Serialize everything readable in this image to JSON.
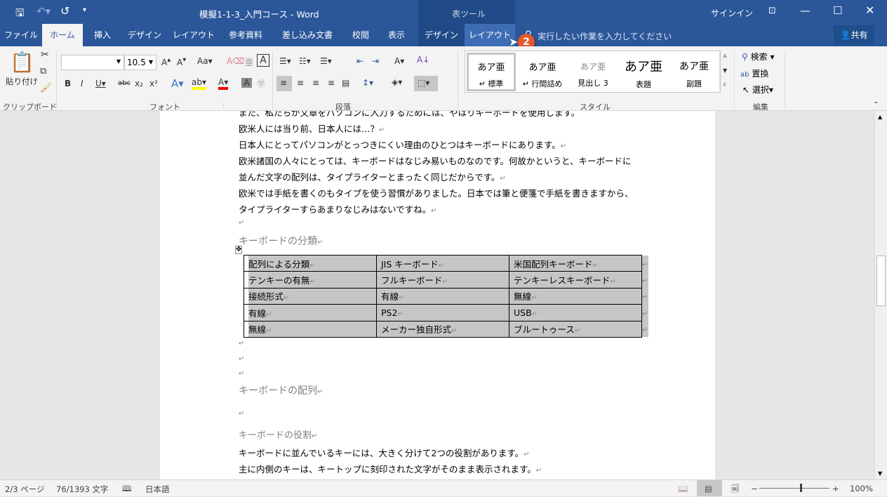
{
  "window": {
    "title": "模擬1-1-3_入門コース  -  Word",
    "table_tools": "表ツール",
    "signin": "サインイン",
    "restore_icon": "ribbon-display-icon"
  },
  "qat": {
    "save": "save-icon",
    "undo": "undo-icon",
    "redo": "redo-icon",
    "customize": "▾"
  },
  "tabs": [
    "ファイル",
    "ホーム",
    "挿入",
    "デザイン",
    "レイアウト",
    "参考資料",
    "差し込み文書",
    "校閲",
    "表示",
    "デザイン",
    "レイアウト"
  ],
  "tell_me": "実行したい作業を入力してください",
  "share": "共有",
  "step_badge": "2",
  "ribbon": {
    "clipboard": {
      "paste": "貼り付け",
      "label": "クリップボード"
    },
    "font": {
      "name": "",
      "size": "10.5",
      "label": "フォント"
    },
    "paragraph": {
      "label": "段落"
    },
    "styles": {
      "items": [
        {
          "preview": "あア亜",
          "name": "↵ 標準"
        },
        {
          "preview": "あア亜",
          "name": "↵ 行間詰め"
        },
        {
          "preview": "あア亜",
          "name": "見出し 3"
        },
        {
          "preview": "あア亜",
          "name": "表題"
        },
        {
          "preview": "あア亜",
          "name": "副題"
        }
      ],
      "label": "スタイル"
    },
    "editing": {
      "find": "検索",
      "replace": "置換",
      "select": "選択",
      "label": "編集"
    }
  },
  "document": {
    "lines": [
      "また、私たちが文章をパソコンに入力するためには、やはりキーボードを使用します。",
      "欧米人には当り前、日本人には…？",
      "日本人にとってパソコンがとっつきにくい理由のひとつはキーボードにあります。",
      "欧米諸国の人々にとっては、キーボードはなじみ易いものなのです。何故かというと、キーボードに",
      "並んだ文字の配列は、タイプライターとまったく同じだからです。",
      "欧米では手紙を書くのもタイプを使う習慣がありました。日本では筆と便箋で手紙を書きますから、",
      "タイプライターすらあまりなじみはないですね。"
    ],
    "heading1": "キーボードの分類",
    "table": [
      [
        "配列による分類",
        "JIS キーボード",
        "米国配列キーボード"
      ],
      [
        "テンキーの有無",
        "フルキーボード",
        "テンキーレスキーボード"
      ],
      [
        "接続形式",
        "有線",
        "無線"
      ],
      [
        "有線",
        "PS2",
        "USB"
      ],
      [
        "無線",
        "メーカー独自形式",
        "ブルートゥース"
      ]
    ],
    "heading2": "キーボードの配列",
    "heading3": "キーボードの役割",
    "lines2": [
      "キーボードに並んでいるキーには、大きく分けて2つの役割があります。",
      "主に内側のキーは、キートップに刻印された文字がそのまま表示されます。"
    ],
    "para_mark": "↵"
  },
  "status": {
    "page": "2/3 ページ",
    "words": "76/1393 文字",
    "language": "日本語",
    "zoom": "100%",
    "zoom_percent": 100
  }
}
